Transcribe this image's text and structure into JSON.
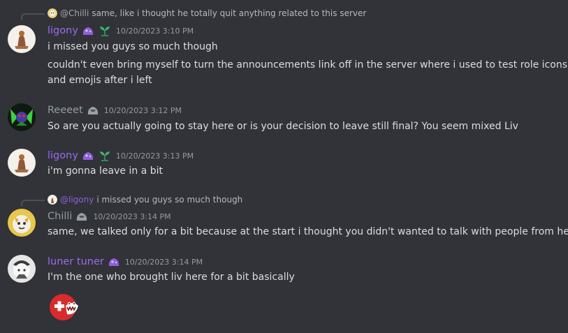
{
  "colors": {
    "background": "#313338",
    "text": "#dbdee1",
    "muted": "#949ba4",
    "purple_name": "#9b6bf2",
    "gray_name": "#949ba4",
    "mention": "#c9cdfb"
  },
  "messages": [
    {
      "reply": {
        "author": "@Chilli",
        "text": "same, like i thought he totally quit anything related to this server"
      },
      "author": "ligony",
      "timestamp": "10/20/2023 3:10 PM",
      "lines": [
        "i missed you guys so much though",
        "couldn't even bring myself to turn the announcements link off in the server where i used to test role icons",
        "and emojis after i left"
      ]
    },
    {
      "author": "Reeeet",
      "timestamp": "10/20/2023 3:12 PM",
      "lines": [
        "So are you actually going to stay here or is your decision to leave still final? You seem mixed Liv"
      ]
    },
    {
      "author": "ligony",
      "timestamp": "10/20/2023 3:13 PM",
      "lines": [
        "i'm gonna leave in a bit"
      ]
    },
    {
      "reply": {
        "author": "@ligony",
        "text": "i missed you guys so much though"
      },
      "author": "Chilli",
      "timestamp": "10/20/2023 3:14 PM",
      "lines": [
        "same, we talked only for a bit because at the start i thought you didn't wanted to talk with people from here"
      ]
    },
    {
      "author": "luner tuner",
      "timestamp": "10/20/2023 3:14 PM",
      "lines": [
        "I'm the one who brought liv here for a bit basically"
      ],
      "emoji": "countryball-emoji"
    }
  ]
}
